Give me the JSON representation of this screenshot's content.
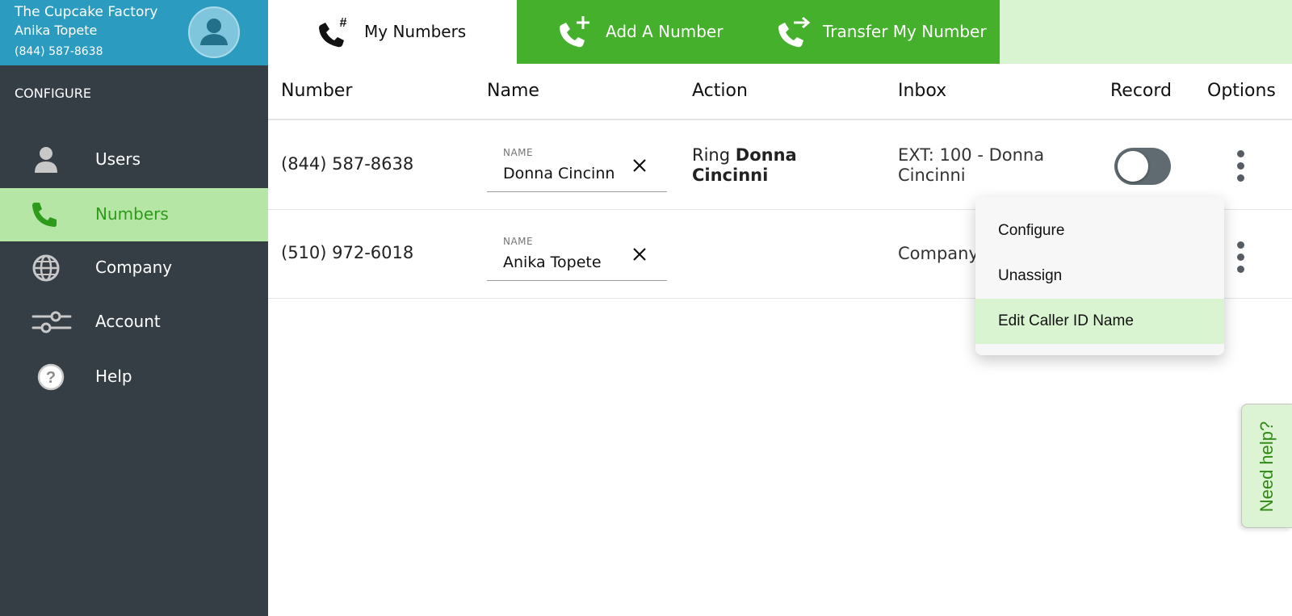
{
  "account": {
    "company": "The Cupcake Factory",
    "user": "Anika Topete",
    "phone": "(844) 587-8638"
  },
  "sidebar": {
    "heading": "CONFIGURE",
    "items": [
      {
        "label": "Users",
        "icon": "user-icon",
        "active": false
      },
      {
        "label": "Numbers",
        "icon": "phone-icon",
        "active": true
      },
      {
        "label": "Company",
        "icon": "globe-icon",
        "active": false
      },
      {
        "label": "Account",
        "icon": "sliders-icon",
        "active": false
      },
      {
        "label": "Help",
        "icon": "help-icon",
        "active": false
      }
    ]
  },
  "tabs": [
    {
      "label": "My Numbers",
      "icon": "phone-hash-icon",
      "active": true
    },
    {
      "label": "Add A Number",
      "icon": "phone-plus-icon",
      "active": false
    },
    {
      "label": "Transfer My Number",
      "icon": "phone-transfer-icon",
      "active": false
    }
  ],
  "table": {
    "headers": [
      "Number",
      "Name",
      "Action",
      "Inbox",
      "Record",
      "Options"
    ],
    "rows": [
      {
        "number": "(844) 587-8638",
        "name_caption": "NAME",
        "name": "Donna Cincinni",
        "action_prefix": "Ring",
        "action_target": "Donna Cincinni",
        "inbox": "EXT: 100 - Donna Cincinni",
        "record": false
      },
      {
        "number": "(510) 972-6018",
        "name_caption": "NAME",
        "name": "Anika Topete",
        "action_prefix": "",
        "action_target": "",
        "inbox": "Company"
      }
    ]
  },
  "options_menu": {
    "items": [
      {
        "label": "Configure",
        "highlighted": false
      },
      {
        "label": "Unassign",
        "highlighted": false
      },
      {
        "label": "Edit Caller ID Name",
        "highlighted": true
      }
    ]
  },
  "help_tab": {
    "label": "Need help?"
  },
  "colors": {
    "sidebar_bg": "#353d45",
    "account_header_bg": "#2b9cc0",
    "active_nav_bg": "#b5e6a5",
    "active_nav_text": "#2e9a1a",
    "tab_green": "#45b02c",
    "tab_light_green": "#d9f4d1"
  }
}
